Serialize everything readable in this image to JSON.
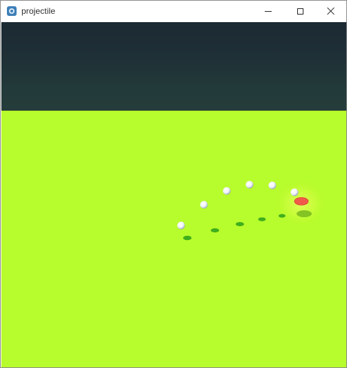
{
  "window": {
    "title": "projectile",
    "icon": "godot-engine-icon",
    "controls": [
      "minimize",
      "maximize",
      "close"
    ]
  },
  "scene": {
    "sky_color": "#1c2932",
    "ground_color": "#b7fc2c",
    "projectile_color": "#ffffff",
    "shadow_color": "#3fae1d",
    "target_color": "#f05a4a",
    "projectile_count": 6,
    "target_count": 1
  }
}
